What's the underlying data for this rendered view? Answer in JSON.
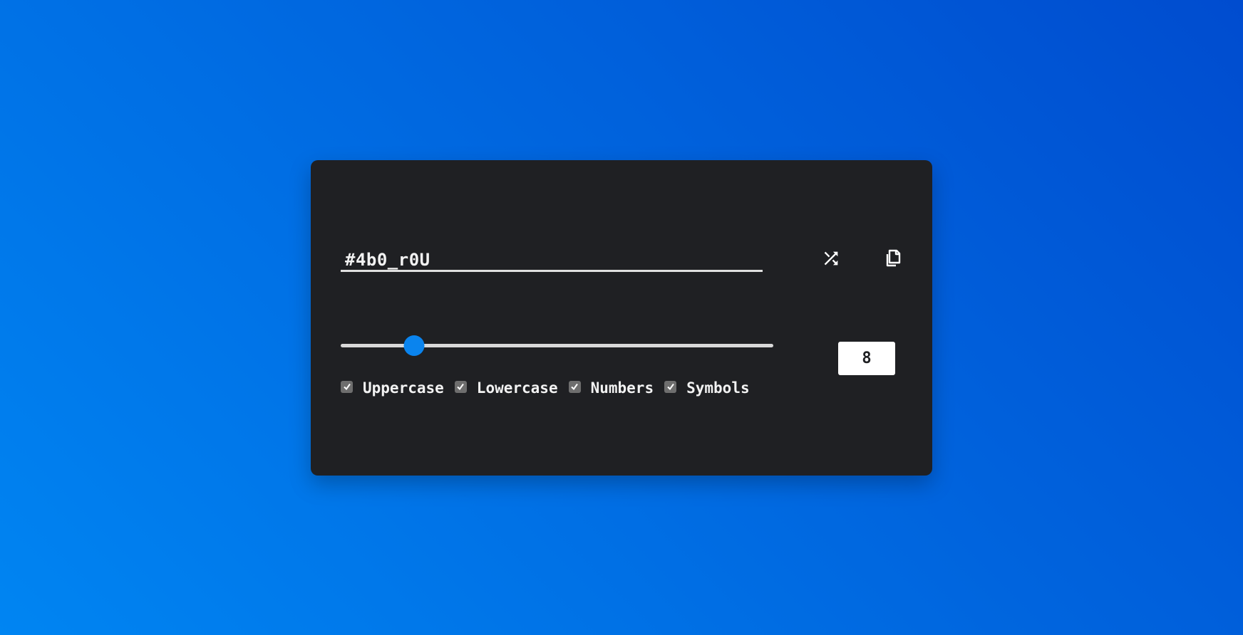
{
  "password": {
    "value": "#4b0_r0U"
  },
  "actions": {
    "shuffle_icon": "shuffle-icon",
    "copy_icon": "copy-icon"
  },
  "length": {
    "value": "8",
    "slider_fraction": 0.17
  },
  "options": [
    {
      "label": "Uppercase",
      "checked": true
    },
    {
      "label": "Lowercase",
      "checked": true
    },
    {
      "label": "Numbers",
      "checked": true
    },
    {
      "label": "Symbols",
      "checked": true
    }
  ],
  "colors": {
    "accent": "#0a84ee",
    "card": "#1f2023",
    "background_start": "#0085f2",
    "background_end": "#004ccf"
  }
}
